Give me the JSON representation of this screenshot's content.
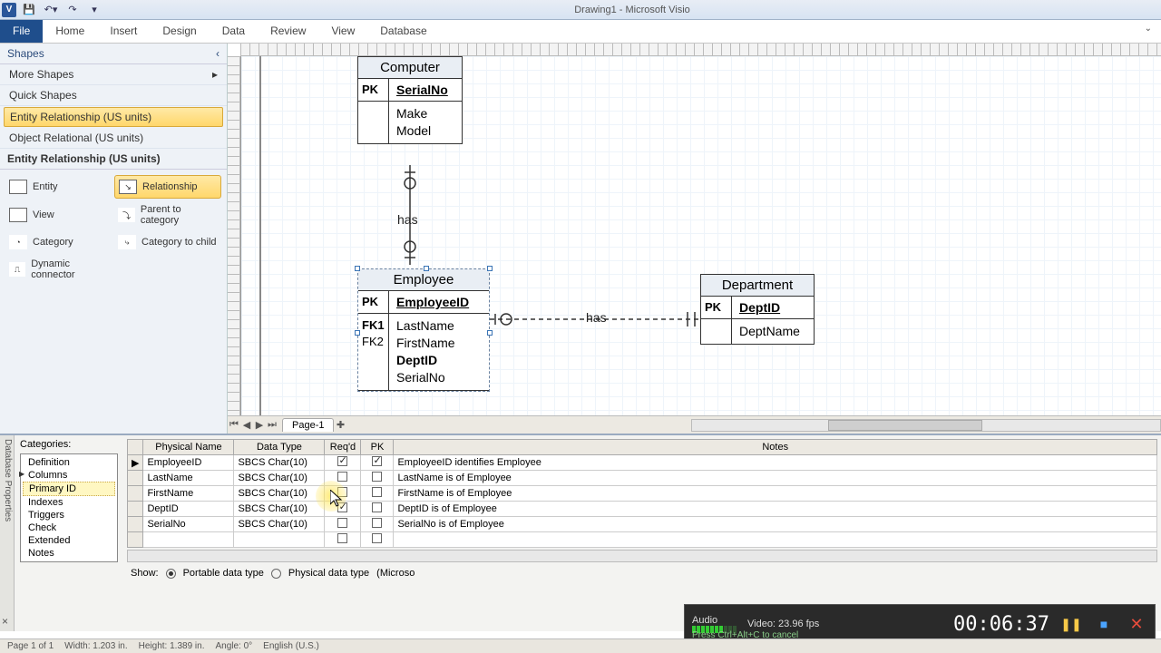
{
  "title": "Drawing1  -  Microsoft Visio",
  "ribbon": {
    "tabs": [
      "File",
      "Home",
      "Insert",
      "Design",
      "Data",
      "Review",
      "View",
      "Database"
    ]
  },
  "shapes": {
    "header": "Shapes",
    "more": "More Shapes",
    "quick": "Quick Shapes",
    "stencils": [
      "Entity Relationship (US units)",
      "Object Relational (US units)"
    ],
    "section": "Entity Relationship (US units)",
    "items": [
      "Entity",
      "Relationship",
      "View",
      "Parent to category",
      "Category",
      "Category to child",
      "Dynamic connector"
    ]
  },
  "pageTab": "Page-1",
  "entities": {
    "computer": {
      "name": "Computer",
      "pk": "PK",
      "pkfield": "SerialNo",
      "fields": [
        "Make",
        "Model"
      ]
    },
    "employee": {
      "name": "Employee",
      "pk": "PK",
      "pkfield": "EmployeeID",
      "fields": [
        "LastName",
        "FirstName",
        "DeptID",
        "SerialNo"
      ],
      "fk": [
        "",
        "",
        "FK1",
        "FK2"
      ]
    },
    "department": {
      "name": "Department",
      "pk": "PK",
      "pkfield": "DeptID",
      "fields": [
        "DeptName"
      ]
    }
  },
  "rel": {
    "has1": "has",
    "has2": "has"
  },
  "db": {
    "sideLabel": "Database Properties",
    "catsHeader": "Categories:",
    "cats": [
      "Definition",
      "Columns",
      "Primary ID",
      "Indexes",
      "Triggers",
      "Check",
      "Extended",
      "Notes"
    ],
    "headers": [
      "Physical Name",
      "Data Type",
      "Req'd",
      "PK",
      "Notes"
    ],
    "rows": [
      {
        "name": "EmployeeID",
        "type": "SBCS Char(10)",
        "req": true,
        "pk": true,
        "notes": "EmployeeID identifies Employee"
      },
      {
        "name": "LastName",
        "type": "SBCS Char(10)",
        "req": false,
        "pk": false,
        "notes": "LastName is of Employee"
      },
      {
        "name": "FirstName",
        "type": "SBCS Char(10)",
        "req": false,
        "pk": false,
        "notes": "FirstName is of Employee"
      },
      {
        "name": "DeptID",
        "type": "SBCS Char(10)",
        "req": true,
        "pk": false,
        "notes": "DeptID is of Employee"
      },
      {
        "name": "SerialNo",
        "type": "SBCS Char(10)",
        "req": false,
        "pk": false,
        "notes": "SerialNo is of Employee"
      }
    ],
    "show": {
      "label": "Show:",
      "opt1": "Portable data type",
      "opt2": "Physical data type",
      "trail": "(Microso"
    }
  },
  "status": {
    "page": "Page 1 of 1",
    "width": "Width: 1.203 in.",
    "height": "Height: 1.389 in.",
    "angle": "Angle: 0°",
    "lang": "English (U.S.)"
  },
  "recorder": {
    "audio": "Audio",
    "video": "Video: 23.96 fps",
    "time": "00:06:37",
    "hint": "Press Ctrl+Alt+C to cancel"
  }
}
